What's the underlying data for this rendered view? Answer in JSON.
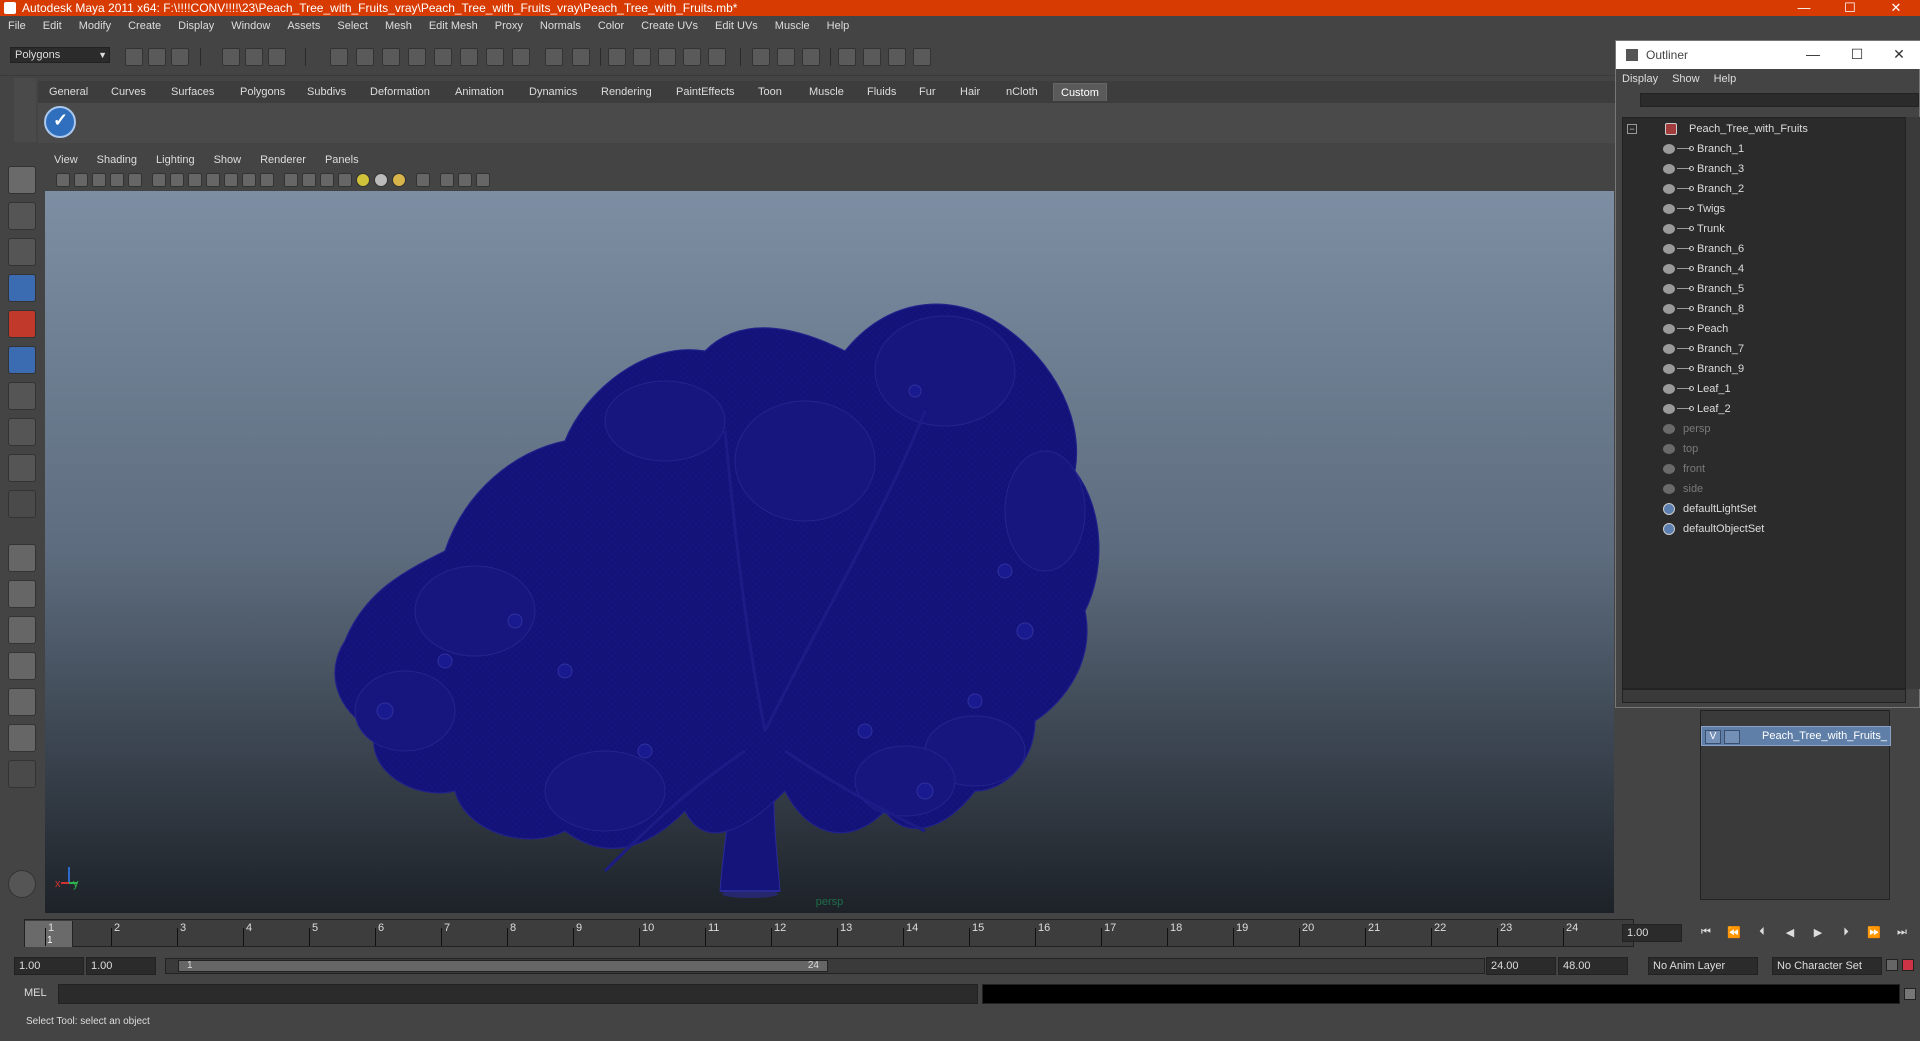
{
  "window": {
    "title": "Autodesk Maya 2011 x64: F:\\!!!!CONV!!!!\\23\\Peach_Tree_with_Fruits_vray\\Peach_Tree_with_Fruits_vray\\Peach_Tree_with_Fruits.mb*",
    "controls": [
      "—",
      "☐",
      "✕"
    ]
  },
  "menubar": [
    "File",
    "Edit",
    "Modify",
    "Create",
    "Display",
    "Window",
    "Assets",
    "Select",
    "Mesh",
    "Edit Mesh",
    "Proxy",
    "Normals",
    "Color",
    "Create UVs",
    "Edit UVs",
    "Muscle",
    "Help"
  ],
  "statusline": {
    "mode": "Polygons"
  },
  "shelf": {
    "tabs": [
      "General",
      "Curves",
      "Surfaces",
      "Polygons",
      "Subdivs",
      "Deformation",
      "Animation",
      "Dynamics",
      "Rendering",
      "PaintEffects",
      "Toon",
      "Muscle",
      "Fluids",
      "Fur",
      "Hair",
      "nCloth",
      "Custom"
    ],
    "active_tab": "Custom",
    "check_icon": "✓"
  },
  "viewport": {
    "menu": [
      "View",
      "Shading",
      "Lighting",
      "Show",
      "Renderer",
      "Panels"
    ],
    "camera_label": "persp",
    "axis_x": "x",
    "axis_y": "y"
  },
  "outliner": {
    "title": "Outliner",
    "controls": [
      "—",
      "☐",
      "✕"
    ],
    "menu": [
      "Display",
      "Show",
      "Help"
    ],
    "root": "Peach_Tree_with_Fruits",
    "children": [
      "Branch_1",
      "Branch_3",
      "Branch_2",
      "Twigs",
      "Trunk",
      "Branch_6",
      "Branch_4",
      "Branch_5",
      "Branch_8",
      "Peach",
      "Branch_7",
      "Branch_9",
      "Leaf_1",
      "Leaf_2"
    ],
    "cameras": [
      "persp",
      "top",
      "front",
      "side"
    ],
    "sets": [
      "defaultLightSet",
      "defaultObjectSet"
    ]
  },
  "layers": {
    "visible_flag": "V",
    "layer_name": "Peach_Tree_with_Fruits_"
  },
  "timeslider": {
    "ticks": [
      "1",
      "2",
      "3",
      "4",
      "5",
      "6",
      "7",
      "8",
      "9",
      "10",
      "11",
      "12",
      "13",
      "14",
      "15",
      "16",
      "17",
      "18",
      "19",
      "20",
      "21",
      "22",
      "23",
      "24"
    ],
    "current_frame": "1",
    "current_time_field": "1.00",
    "playback_buttons": [
      "⏮",
      "⏪",
      "⏴",
      "◀",
      "▶",
      "⏵",
      "⏩",
      "⏭"
    ]
  },
  "range": {
    "start_time": "1.00",
    "playback_start": "1.00",
    "slider_start": "1",
    "slider_end": "24",
    "playback_end": "24.00",
    "end_time": "48.00",
    "anim_layer": "No Anim Layer",
    "character_set": "No Character Set"
  },
  "command": {
    "label": "MEL"
  },
  "help": {
    "text": "Select Tool: select an object"
  }
}
